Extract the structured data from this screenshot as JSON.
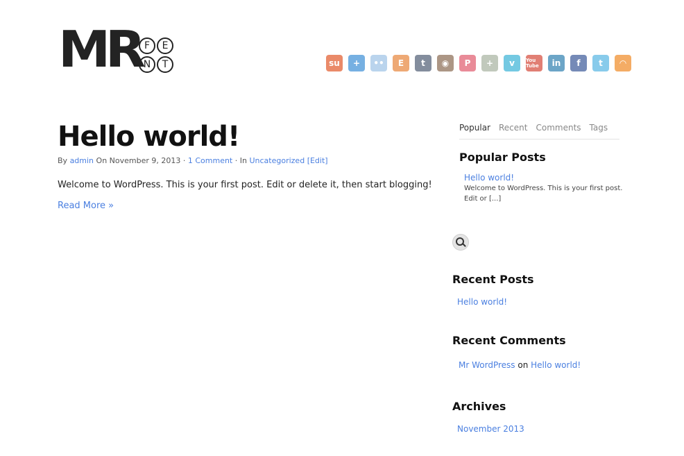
{
  "logo": {
    "mark": "MR",
    "letters": [
      "F",
      "E",
      "N",
      "T"
    ]
  },
  "social_icons": [
    {
      "name": "stumbleupon-icon",
      "glyph": "su",
      "color": "#e25a2b"
    },
    {
      "name": "google-plus-icon",
      "glyph": "+",
      "color": "#3d8fd6"
    },
    {
      "name": "flickr-icon",
      "glyph": "••",
      "color": "#9ec3e6"
    },
    {
      "name": "etsy-icon",
      "glyph": "E",
      "color": "#e8863b"
    },
    {
      "name": "tumblr-icon",
      "glyph": "t",
      "color": "#4f5e74"
    },
    {
      "name": "instagram-icon",
      "glyph": "◉",
      "color": "#8a6a52"
    },
    {
      "name": "pinterest-icon",
      "glyph": "P",
      "color": "#e15b6d"
    },
    {
      "name": "google-plus-alt-icon",
      "glyph": "+",
      "color": "#a8b3a0"
    },
    {
      "name": "vimeo-icon",
      "glyph": "v",
      "color": "#3ab3d6"
    },
    {
      "name": "youtube-icon",
      "glyph": "You Tube",
      "color": "#d54a3a"
    },
    {
      "name": "linkedin-icon",
      "glyph": "in",
      "color": "#2e7fb0"
    },
    {
      "name": "facebook-icon",
      "glyph": "f",
      "color": "#3b5a9a"
    },
    {
      "name": "twitter-icon",
      "glyph": "t",
      "color": "#56b6e3"
    },
    {
      "name": "rss-icon",
      "glyph": "◠",
      "color": "#f08a24"
    }
  ],
  "post": {
    "title": "Hello world!",
    "meta": {
      "by": "By",
      "author": "admin",
      "on": "On November 9, 2013 ·",
      "comments": "1 Comment",
      "sep": "· In",
      "category": "Uncategorized",
      "edit": "[Edit]"
    },
    "body": "Welcome to WordPress. This is your first post. Edit or delete it, then start blogging!",
    "read_more": "Read More »"
  },
  "sidebar": {
    "tabs": [
      "Popular",
      "Recent",
      "Comments",
      "Tags"
    ],
    "popular": {
      "heading": "Popular Posts",
      "link": "Hello world!",
      "excerpt": "Welcome to WordPress. This is your first post. Edit or [...]"
    },
    "recent_posts": {
      "heading": "Recent Posts",
      "link": "Hello world!"
    },
    "recent_comments": {
      "heading": "Recent Comments",
      "author": "Mr WordPress",
      "on": "on",
      "post": "Hello world!"
    },
    "archives": {
      "heading": "Archives",
      "link": "November 2013"
    }
  }
}
